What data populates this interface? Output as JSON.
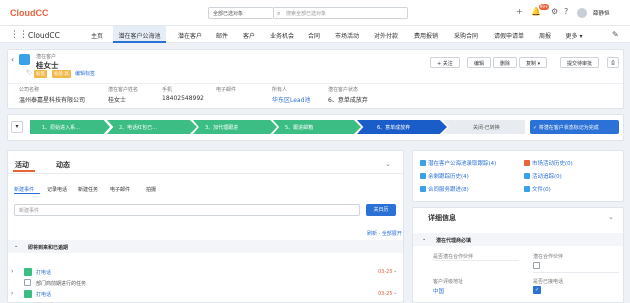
{
  "app": {
    "logo": "CloudCC",
    "name": "CloudCC"
  },
  "topbar": {
    "scope": "全部已选对象",
    "search_placeholder": "搜索全部已选对象",
    "notif_count": "99+",
    "user": "薛静恒"
  },
  "nav": [
    "主页",
    "潜在客户公海池",
    "潜在客户",
    "邮件",
    "客户",
    "业务机会",
    "合同",
    "市场活动",
    "对外付款",
    "费用报销",
    "采购合同",
    "请假申请单",
    "周报",
    "更多"
  ],
  "record": {
    "type": "潜在客户",
    "name": "桂女士",
    "tags": [
      "标签",
      "标签·高"
    ],
    "edit_tags": "编辑标签",
    "actions": [
      "+ 关注",
      "编辑",
      "删除",
      "复制",
      "提交待审批"
    ],
    "fields": [
      {
        "label": "公司名称",
        "value": "温州泰嘉星科技有限公司"
      },
      {
        "label": "潜在客户姓名",
        "value": "桂女士"
      },
      {
        "label": "手机",
        "value": "18402548992"
      },
      {
        "label": "电子邮件",
        "value": ""
      },
      {
        "label": "所有人",
        "value": "华东区Lead池"
      },
      {
        "label": "潜在客户状态",
        "value": "6、意单成放弃"
      }
    ]
  },
  "path": {
    "steps": [
      "1、原始进入系...",
      "2、电话红包已...",
      "3、加代理跟进",
      "5、跟进邮箱",
      "6、意单成放弃",
      "关闭-已转换"
    ],
    "mark_button": "将潜在客户状态标记为完成"
  },
  "activity": {
    "tabs": [
      "活动",
      "动态"
    ],
    "subtabs": [
      "新建事件",
      "记录电话",
      "新建任务",
      "电子邮件",
      "拍摄"
    ],
    "input_placeholder": "新建事件",
    "save_button": "关日历",
    "refresh": "刷新 · 全部展开",
    "section": "即将到来和已逾期",
    "items": [
      {
        "title": "打电话",
        "date": "03-25"
      },
      {
        "title": "打电话",
        "sub": "部门商前期进行的任务",
        "date": "03-25"
      }
    ]
  },
  "related": {
    "left": [
      "潜在客户公海池录取跟踪(4)",
      "余剩跟踪历史(4)",
      "合同服务跟进(8)"
    ],
    "right": [
      "市场活动历史(0)",
      "活动追踪(0)",
      "文件(0)"
    ]
  },
  "details": {
    "title": "详细信息",
    "section": "潜在代理商必填",
    "fields": [
      {
        "label": "是否潜在合作伙伴",
        "value": ""
      },
      {
        "label": "潜在合作伙伴",
        "value": ""
      },
      {
        "label": "客户评级地址",
        "value": "中国"
      },
      {
        "label": "是否已接电话",
        "value": "✓"
      }
    ]
  }
}
